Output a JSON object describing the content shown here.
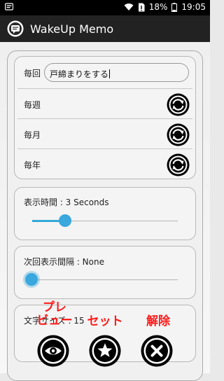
{
  "status_bar": {
    "battery_percent": "18%",
    "time": "19:05"
  },
  "app_bar": {
    "title": "WakeUp Memo"
  },
  "memo": {
    "label": "毎回",
    "value": "戸締まりをする"
  },
  "repeat_rows": [
    {
      "label": "毎週",
      "icon": "repeat-icon"
    },
    {
      "label": "毎月",
      "icon": "repeat-icon"
    },
    {
      "label": "毎年",
      "icon": "repeat-icon"
    }
  ],
  "display_time": {
    "label": "表示時間 : 3 Seconds",
    "value_fraction": 0.23
  },
  "next_interval": {
    "label": "次回表示間隔 : None",
    "value_fraction": 0.0
  },
  "font_size": {
    "label": "文字サイズ : 15"
  },
  "actions": {
    "preview_label_line1": "プレ",
    "preview_label_line2": "ビュー",
    "set_label": "セット",
    "cancel_label": "解除"
  },
  "colors": {
    "accent": "#33a9d8",
    "action_label": "#ff1a1a"
  }
}
